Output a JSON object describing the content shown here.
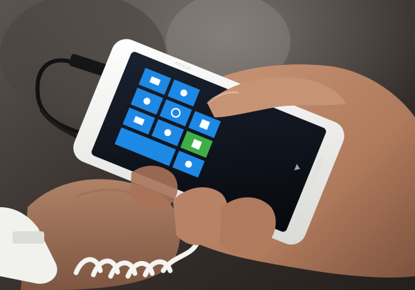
{
  "photo": {
    "subject": "smartphone-held-in-hand",
    "phone": {
      "brand": "NOKIA",
      "body_color": "#f4f4f2",
      "screen_color": "#0b0d12",
      "tile_color": "#1e88e5",
      "accent_tile_color": "#3fae49",
      "tiles": [
        {
          "icon": "message-icon",
          "color": "#1e88e5"
        },
        {
          "icon": "phone-icon",
          "color": "#1e88e5"
        },
        {
          "icon": "people-icon",
          "color": "#1e88e5"
        },
        {
          "icon": "browser-icon",
          "color": "#1e88e5"
        },
        {
          "icon": "calendar-icon",
          "color": "#1e88e5"
        },
        {
          "icon": "email-icon",
          "color": "#1e88e5"
        },
        {
          "icon": "store-icon",
          "color": "#3fae49"
        },
        {
          "icon": "music-icon",
          "color": "#1e88e5"
        },
        {
          "icon": "settings-icon",
          "color": "#1e88e5"
        }
      ]
    },
    "cable_color": "#121212",
    "security_tether_color": "#f1f1ee",
    "skin_tone": "#b98668",
    "background_color": "#3a3330"
  }
}
